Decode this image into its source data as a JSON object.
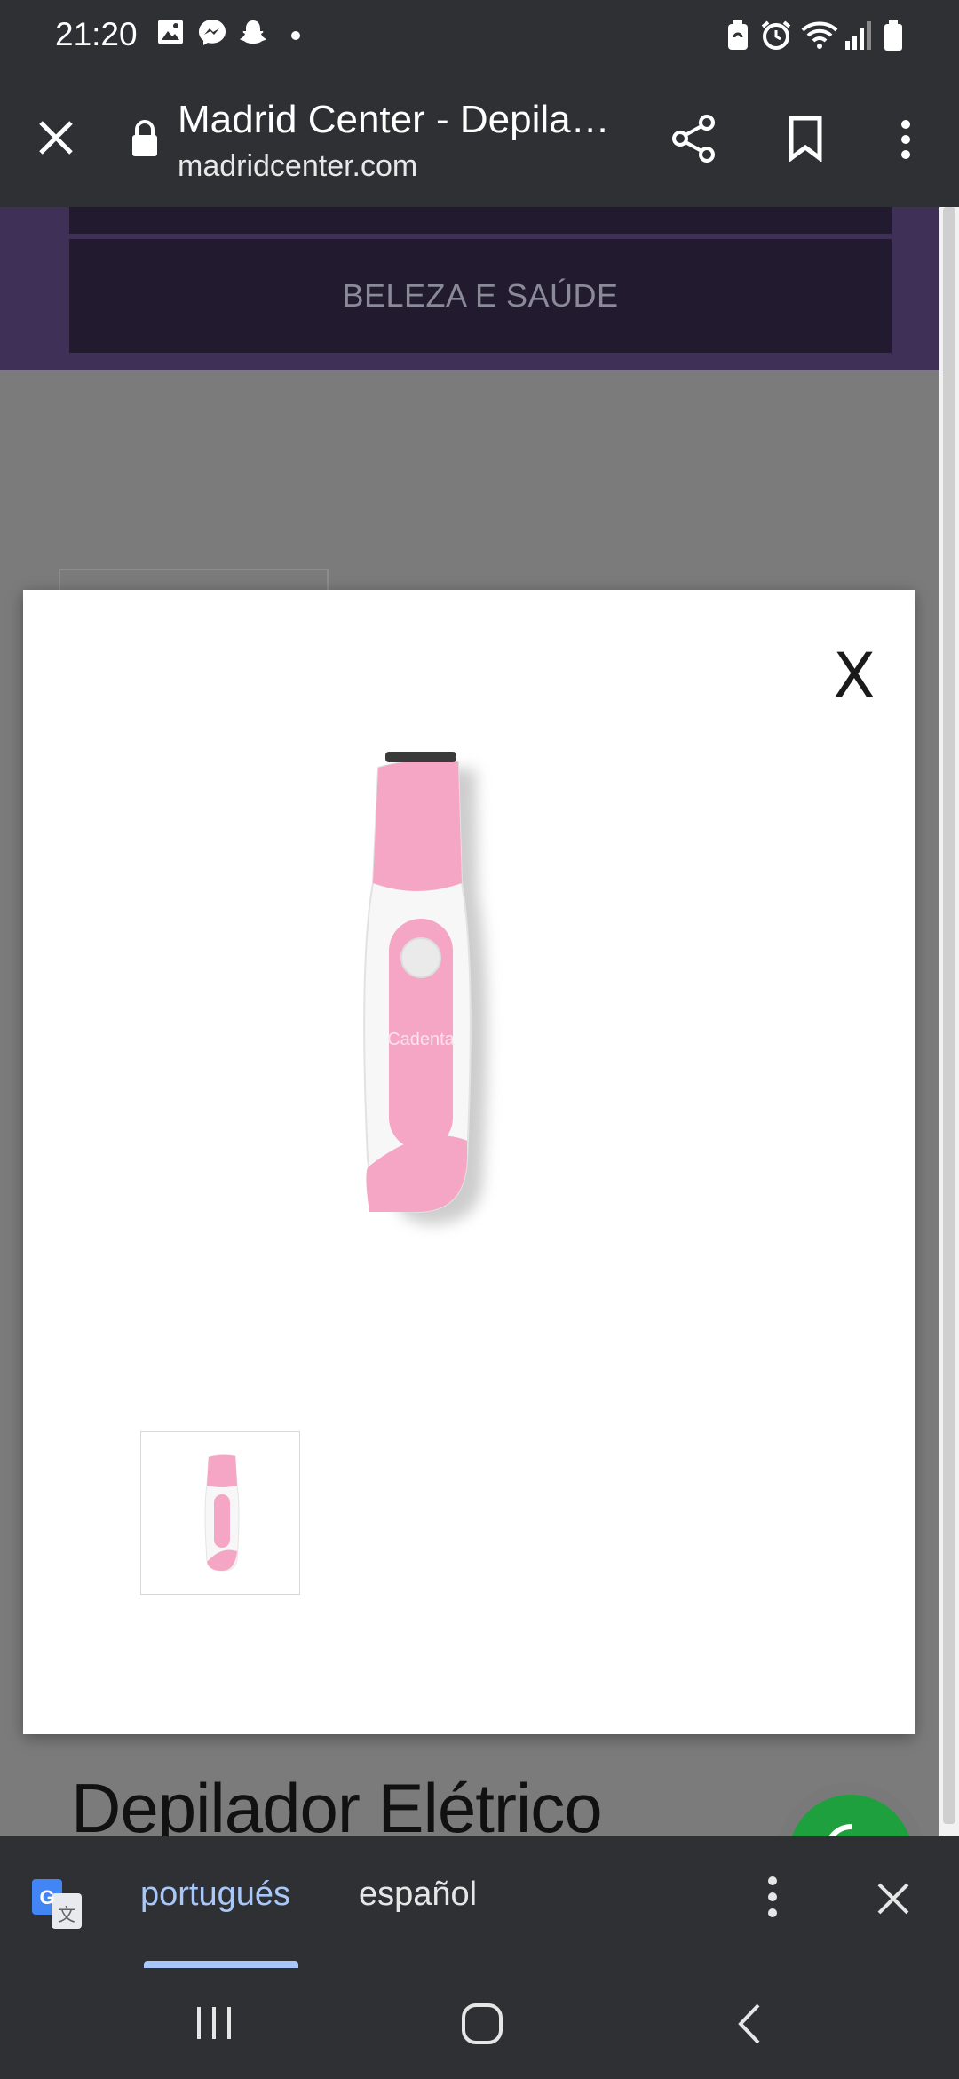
{
  "status_bar": {
    "time": "21:20",
    "notification_icons": [
      "gallery-icon",
      "messenger-icon",
      "snapchat-icon",
      "dot-icon"
    ],
    "system_icons": [
      "battery-saver-icon",
      "alarm-icon",
      "wifi-icon",
      "signal-icon",
      "battery-icon"
    ]
  },
  "toolbar": {
    "title": "Madrid Center - Depila…",
    "url": "madridcenter.com"
  },
  "page": {
    "category_label": "BELEZA E SAÚDE",
    "product_title": "Depilador Elétrico"
  },
  "modal": {
    "close_label": "X",
    "product_brand_on_image": "Cadenta"
  },
  "translate_bar": {
    "languages": [
      "portugués",
      "español"
    ],
    "selected": "portugués"
  },
  "colors": {
    "chrome": "#2f3033",
    "accent": "#a8c7fa",
    "page_purple": "#3f3057",
    "product_pink": "#f4a9c7"
  }
}
